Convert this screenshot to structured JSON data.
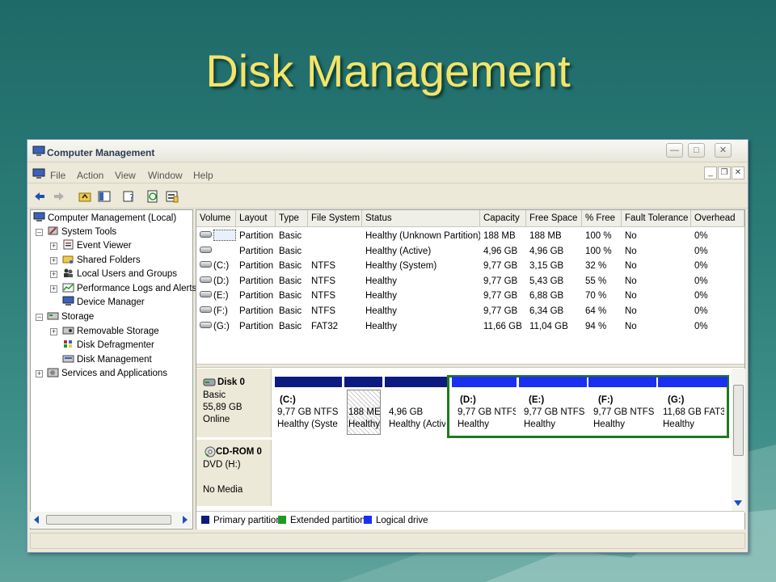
{
  "slide": {
    "title": "Disk Management"
  },
  "window": {
    "title": "Computer Management",
    "menu": [
      "File",
      "Action",
      "View",
      "Window",
      "Help"
    ]
  },
  "tree": {
    "root": "Computer Management (Local)",
    "system_tools": "System Tools",
    "event_viewer": "Event Viewer",
    "shared_folders": "Shared Folders",
    "local_users": "Local Users and Groups",
    "perf_logs": "Performance Logs and Alerts",
    "device_manager": "Device Manager",
    "storage": "Storage",
    "removable_storage": "Removable Storage",
    "disk_defrag": "Disk Defragmenter",
    "disk_management": "Disk Management",
    "services_apps": "Services and Applications"
  },
  "volumes": {
    "columns": [
      "Volume",
      "Layout",
      "Type",
      "File System",
      "Status",
      "Capacity",
      "Free Space",
      "% Free",
      "Fault Tolerance",
      "Overhead"
    ],
    "rows": [
      {
        "volume": "",
        "layout": "Partition",
        "type": "Basic",
        "fs": "",
        "status": "Healthy (Unknown Partition)",
        "capacity": "188 MB",
        "free": "188 MB",
        "pct": "100 %",
        "fault": "No",
        "overhead": "0%"
      },
      {
        "volume": "",
        "layout": "Partition",
        "type": "Basic",
        "fs": "",
        "status": "Healthy (Active)",
        "capacity": "4,96 GB",
        "free": "4,96 GB",
        "pct": "100 %",
        "fault": "No",
        "overhead": "0%"
      },
      {
        "volume": "(C:)",
        "layout": "Partition",
        "type": "Basic",
        "fs": "NTFS",
        "status": "Healthy (System)",
        "capacity": "9,77 GB",
        "free": "3,15 GB",
        "pct": "32 %",
        "fault": "No",
        "overhead": "0%"
      },
      {
        "volume": "(D:)",
        "layout": "Partition",
        "type": "Basic",
        "fs": "NTFS",
        "status": "Healthy",
        "capacity": "9,77 GB",
        "free": "5,43 GB",
        "pct": "55 %",
        "fault": "No",
        "overhead": "0%"
      },
      {
        "volume": "(E:)",
        "layout": "Partition",
        "type": "Basic",
        "fs": "NTFS",
        "status": "Healthy",
        "capacity": "9,77 GB",
        "free": "6,88 GB",
        "pct": "70 %",
        "fault": "No",
        "overhead": "0%"
      },
      {
        "volume": "(F:)",
        "layout": "Partition",
        "type": "Basic",
        "fs": "NTFS",
        "status": "Healthy",
        "capacity": "9,77 GB",
        "free": "6,34 GB",
        "pct": "64 %",
        "fault": "No",
        "overhead": "0%"
      },
      {
        "volume": "(G:)",
        "layout": "Partition",
        "type": "Basic",
        "fs": "FAT32",
        "status": "Healthy",
        "capacity": "11,66 GB",
        "free": "11,04 GB",
        "pct": "94 %",
        "fault": "No",
        "overhead": "0%"
      }
    ]
  },
  "disk0": {
    "name": "Disk 0",
    "type": "Basic",
    "size": "55,89 GB",
    "state": "Online",
    "partitions": [
      {
        "label": "(C:)",
        "size": "9,77 GB NTFS",
        "status": "Healthy (Syste"
      },
      {
        "label": "",
        "size": "188 ME",
        "status": "Healthy"
      },
      {
        "label": "",
        "size": "4,96 GB",
        "status": "Healthy (Activ"
      },
      {
        "label": "(D:)",
        "size": "9,77 GB NTFS",
        "status": "Healthy"
      },
      {
        "label": "(E:)",
        "size": "9,77 GB NTFS",
        "status": "Healthy"
      },
      {
        "label": "(F:)",
        "size": "9,77 GB NTFS",
        "status": "Healthy"
      },
      {
        "label": "(G:)",
        "size": "11,68 GB FAT3",
        "status": "Healthy"
      }
    ]
  },
  "cdrom": {
    "name": "CD-ROM 0",
    "type": "DVD (H:)",
    "state": "No Media"
  },
  "legend": {
    "primary": "Primary partition",
    "extended": "Extended partition",
    "logical": "Logical drive"
  },
  "colors": {
    "primary": "#0c1b80",
    "logical": "#1a2ff0",
    "extended": "#1e7a1e",
    "title": "#f4e46a"
  }
}
